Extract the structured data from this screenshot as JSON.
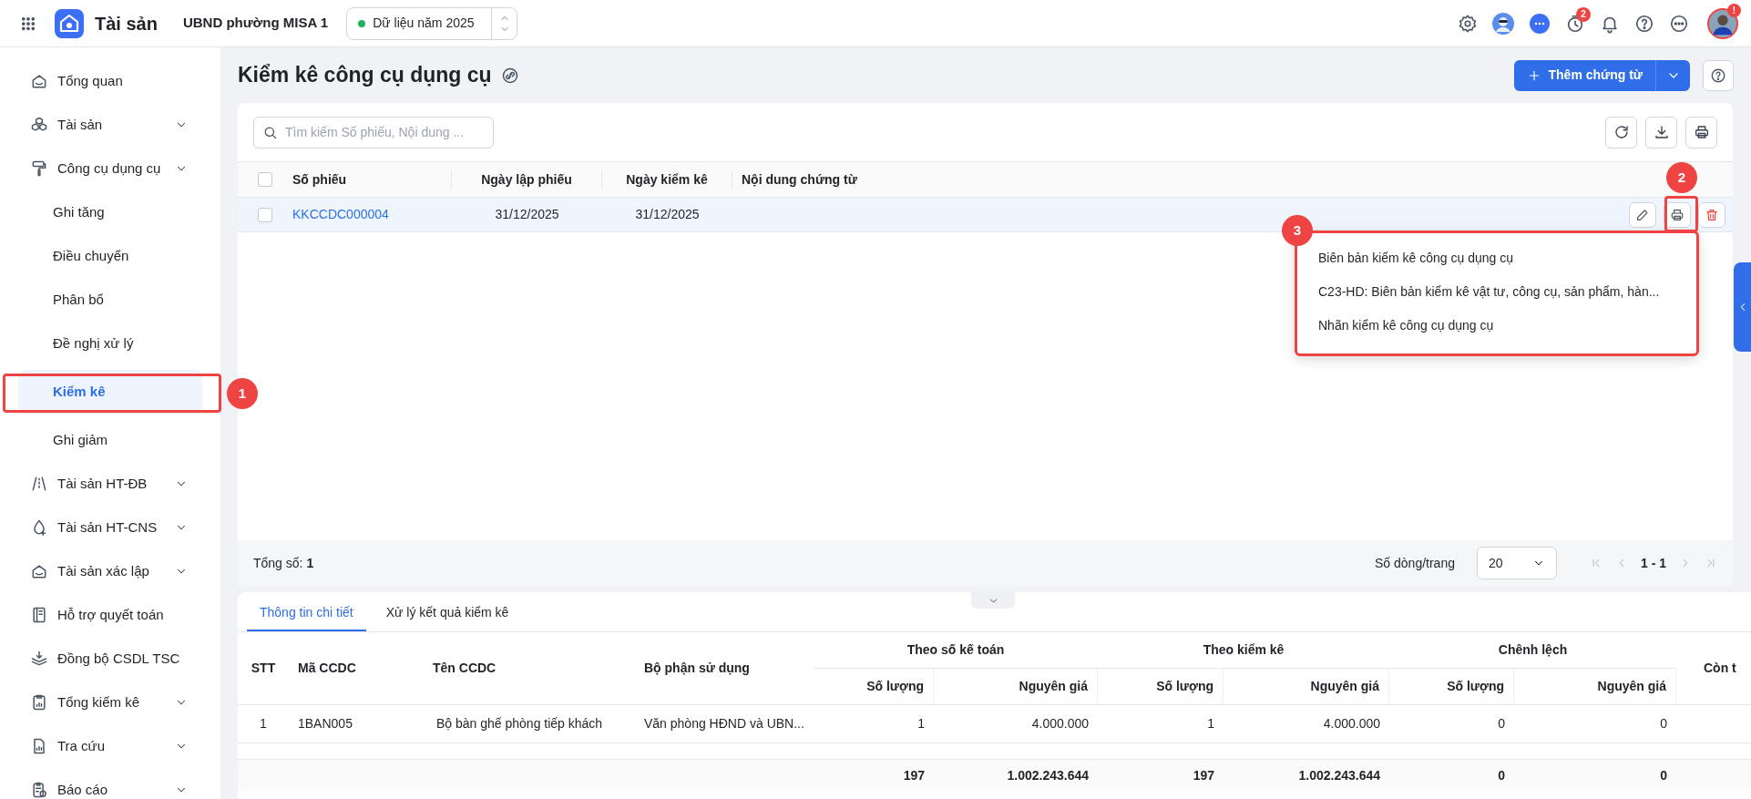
{
  "topbar": {
    "app_name": "Tài sản",
    "org": "UBND phường MISA 1",
    "data_year": "Dữ liệu năm 2025",
    "notification_count": "2",
    "avatar_badge": "!"
  },
  "sidebar": {
    "items": [
      {
        "label": "Tổng quan",
        "expandable": false,
        "selected": false
      },
      {
        "label": "Tài sản",
        "expandable": true,
        "selected": false
      },
      {
        "label": "Công cụ dụng cụ",
        "expandable": true,
        "selected": false,
        "children": [
          {
            "label": "Ghi tăng",
            "selected": false
          },
          {
            "label": "Điều chuyển",
            "selected": false
          },
          {
            "label": "Phân bổ",
            "selected": false
          },
          {
            "label": "Đề nghị xử lý",
            "selected": false
          },
          {
            "label": "Kiểm kê",
            "selected": true
          },
          {
            "label": "Ghi giảm",
            "selected": false
          }
        ]
      },
      {
        "label": "Tài sản HT-ĐB",
        "expandable": true,
        "selected": false
      },
      {
        "label": "Tài sản HT-CNS",
        "expandable": true,
        "selected": false
      },
      {
        "label": "Tài sản xác lập",
        "expandable": true,
        "selected": false
      },
      {
        "label": "Hỗ trợ quyết toán",
        "expandable": false,
        "selected": false
      },
      {
        "label": "Đồng bộ CSDL TSC",
        "expandable": false,
        "selected": false
      },
      {
        "label": "Tổng kiểm kê",
        "expandable": true,
        "selected": false
      },
      {
        "label": "Tra cứu",
        "expandable": true,
        "selected": false
      },
      {
        "label": "Báo cáo",
        "expandable": true,
        "selected": false
      }
    ]
  },
  "page": {
    "title": "Kiểm kê công cụ dụng cụ",
    "add_button": "Thêm chứng từ"
  },
  "search": {
    "placeholder": "Tìm kiếm Số phiếu, Nội dung ..."
  },
  "table": {
    "select_all_checked": false,
    "columns": [
      "Số phiếu",
      "Ngày lập phiếu",
      "Ngày kiểm kê",
      "Nội dung chứng từ"
    ],
    "rows": [
      {
        "checked": false,
        "selected": true,
        "cells": [
          "KKCCDC000004",
          "31/12/2025",
          "31/12/2025",
          ""
        ]
      }
    ]
  },
  "print_menu": {
    "items": [
      "Biên bản kiểm kê công cụ dụng cụ",
      "C23-HD: Biên bản kiểm kê vật tư, công cụ, sản phẩm, hàn...",
      "Nhãn kiểm kê công cụ dụng cụ"
    ]
  },
  "footer": {
    "total_label": "Tổng số:",
    "total": "1",
    "page_size_label": "Số dòng/trang",
    "page_size": "20",
    "range": "1 - 1"
  },
  "detail": {
    "tabs": [
      {
        "label": "Thông tin chi tiết",
        "selected": true
      },
      {
        "label": "Xử lý kết quả kiểm kê",
        "selected": false
      }
    ],
    "columns": [
      "STT",
      "Mã CCDC",
      "Tên CCDC",
      "Bộ phận sử dụng"
    ],
    "groups": [
      {
        "label": "Theo số kế toán",
        "columns": [
          "Số lượng",
          "Nguyên giá"
        ]
      },
      {
        "label": "Theo kiểm kê",
        "columns": [
          "Số lượng",
          "Nguyên giá"
        ]
      },
      {
        "label": "Chênh lệch",
        "columns": [
          "Số lượng",
          "Nguyên giá"
        ]
      }
    ],
    "column_cut": "Còn t",
    "rows": [
      [
        "1",
        "1BAN005",
        "Bộ bàn ghế phòng tiếp khách",
        "Văn phòng HĐND và UBN...",
        "1",
        "4.000.000",
        "1",
        "4.000.000",
        "0",
        "0"
      ]
    ],
    "totals": [
      "197",
      "1.002.243.644",
      "197",
      "1.002.243.644",
      "0",
      "0"
    ]
  },
  "callouts": [
    "1",
    "2",
    "3"
  ]
}
